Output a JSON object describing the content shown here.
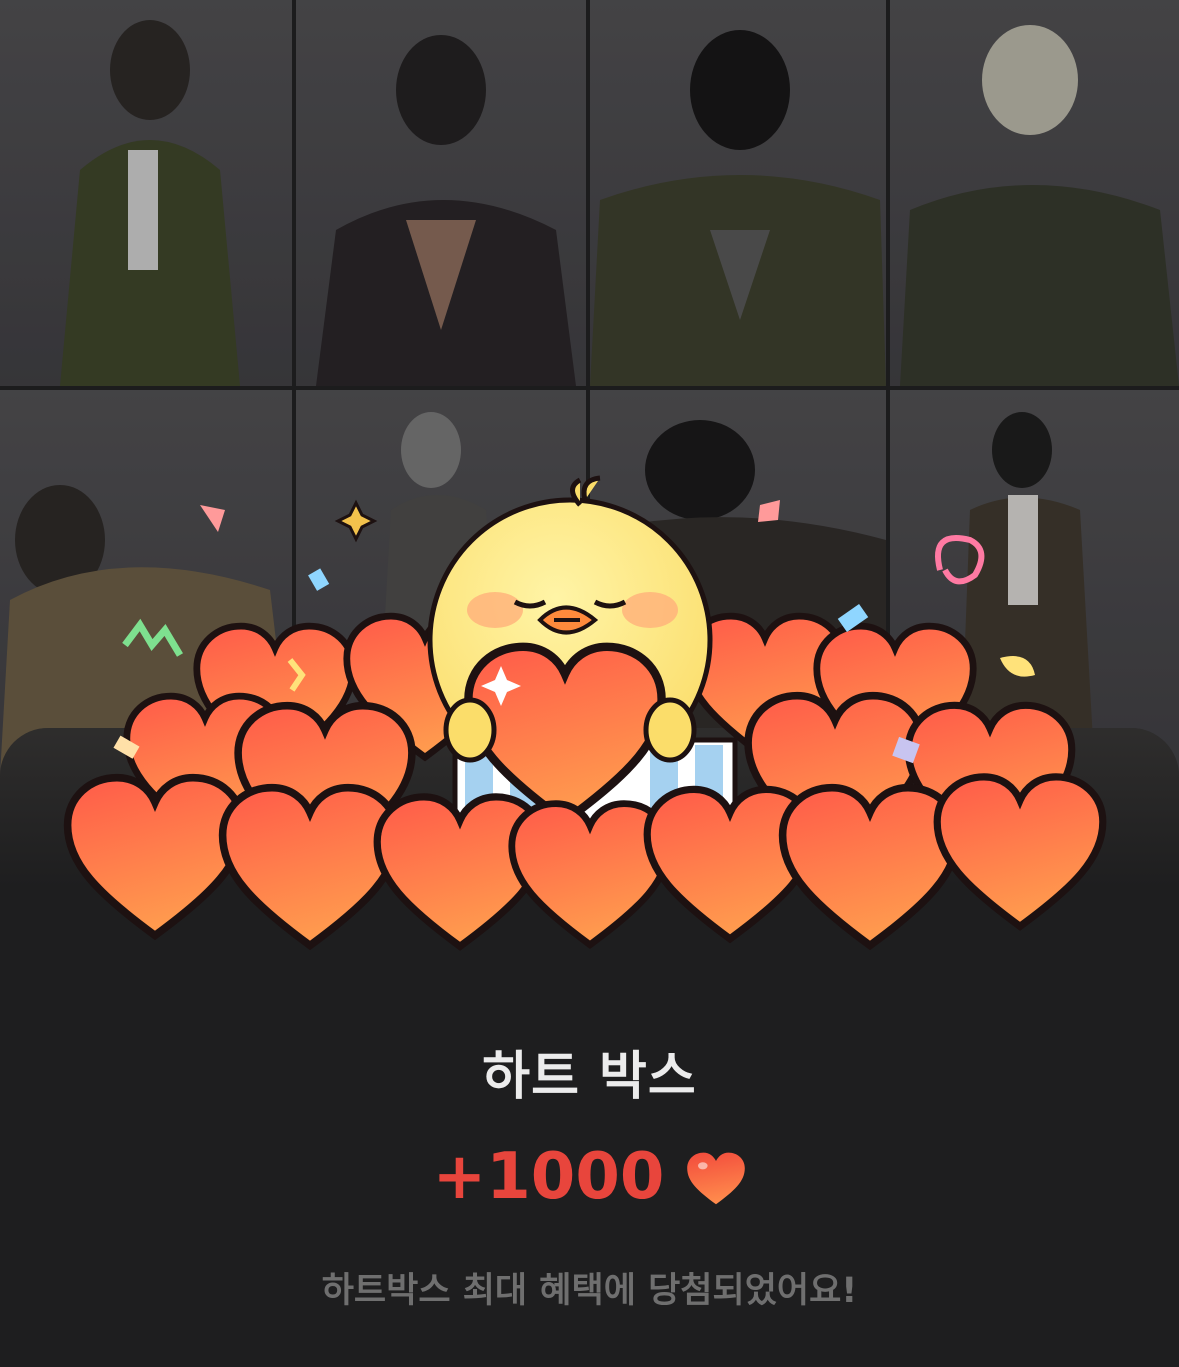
{
  "popup": {
    "title": "하트 박스",
    "reward_amount": "+1000",
    "reward_icon": "heart-icon",
    "description": "하트박스 최대 혜택에 당첨되었어요!"
  },
  "illustration": {
    "character": "yellow-chick-character",
    "items": "pile-of-hearts"
  },
  "colors": {
    "sheet_background": "#1e1e1f",
    "title": "#ececec",
    "reward": "#e8453c",
    "description": "#6f6f6f",
    "heart_top": "#ff6a4a",
    "heart_bottom": "#f24a3c"
  }
}
